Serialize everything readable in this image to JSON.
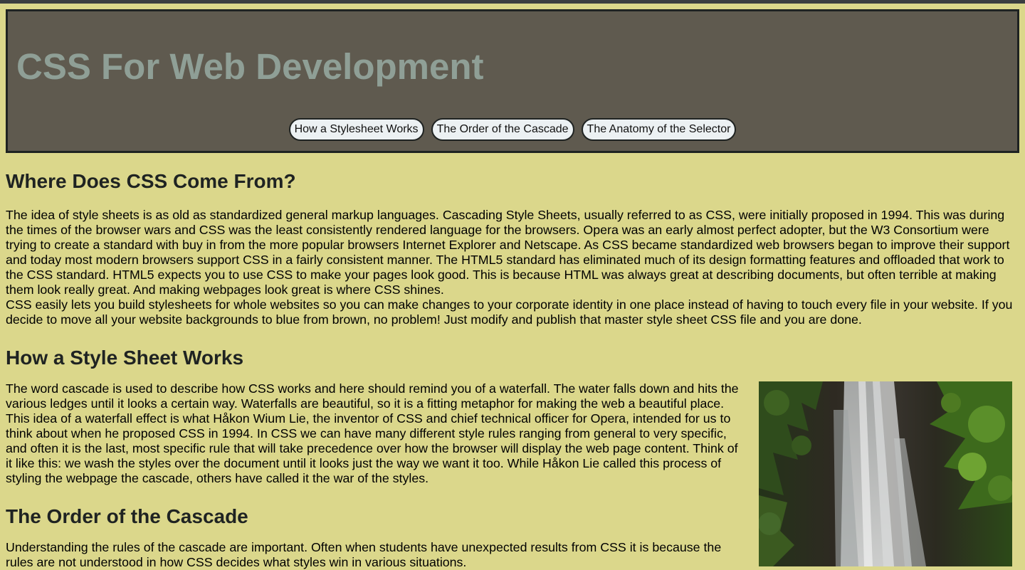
{
  "header": {
    "title": "CSS For Web Development",
    "nav": [
      {
        "label": "How a Stylesheet Works"
      },
      {
        "label": "The Order of the Cascade"
      },
      {
        "label": "The Anatomy of the Selector"
      }
    ]
  },
  "sections": [
    {
      "heading": "Where Does CSS Come From?",
      "paragraphs": [
        "The idea of style sheets is as old as standardized general markup languages. Cascading Style Sheets, usually referred to as CSS, were initially proposed in 1994. This was during the times of the browser wars and CSS was the least consistently rendered language for the browsers. Opera was an early almost perfect adopter, but the W3 Consortium were trying to create a standard with buy in from the more popular browsers Internet Explorer and Netscape. As CSS became standardized web browsers began to improve their support and today most modern browsers support CSS in a fairly consistent manner. The HTML5 standard has eliminated much of its design formatting features and offloaded that work to the CSS standard. HTML5 expects you to use CSS to make your pages look good. This is because HTML was always great at describing documents, but often terrible at making them look really great. And making webpages look great is where CSS shines.",
        "CSS easily lets you build stylesheets for whole websites so you can make changes to your corporate identity in one place instead of having to touch every file in your website. If you decide to move all your website backgrounds to blue from brown, no problem! Just modify and publish that master style sheet CSS file and you are done."
      ]
    },
    {
      "heading": "How a Style Sheet Works",
      "paragraphs": [
        "The word cascade is used to describe how CSS works and here should remind you of a waterfall. The water falls down and hits the various ledges until it looks a certain way. Waterfalls are beautiful, so it is a fitting metaphor for making the web a beautiful place. This idea of a waterfall effect is what Håkon Wium Lie, the inventor of CSS and chief technical officer for Opera, intended for us to think about when he proposed CSS in 1994. In CSS we can have many different style rules ranging from general to very specific, and often it is the last, most specific rule that will take precedence over how the browser will display the web page content. Think of it like this: we wash the styles over the document until it looks just the way we want it too. While Håkon Lie called this process of styling the webpage the cascade, others have called it the war of the styles."
      ]
    },
    {
      "heading": "The Order of the Cascade",
      "paragraphs": [
        "Understanding the rules of the cascade are important. Often when students have unexpected results from CSS it is because the rules are not understood in how CSS decides what styles win in various situations."
      ]
    }
  ],
  "colors": {
    "page_background": "#dbd78b",
    "header_background": "#5f5a4f",
    "title_color": "#8f9f96",
    "border": "#1f2322",
    "nav_button_background": "#ecf1f3"
  },
  "image": {
    "icon": "waterfall-photo"
  }
}
